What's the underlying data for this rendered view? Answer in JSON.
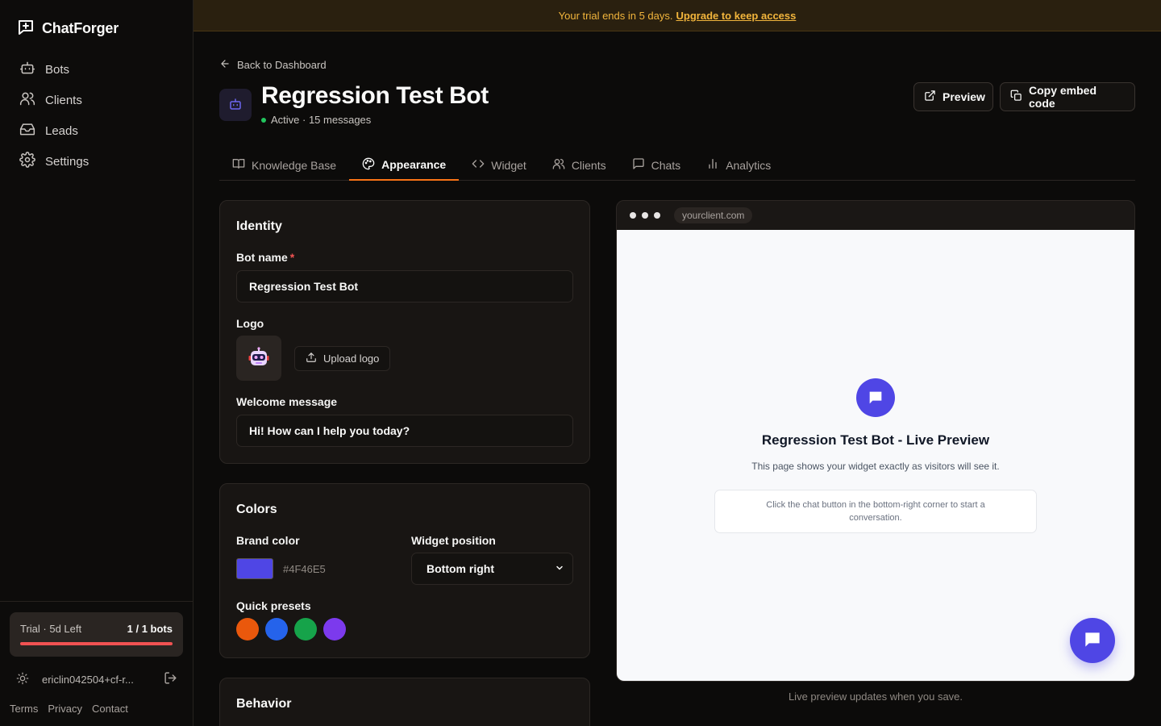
{
  "app": {
    "name": "ChatForger"
  },
  "sidebar": {
    "items": [
      {
        "label": "Bots",
        "icon": "bot-icon"
      },
      {
        "label": "Clients",
        "icon": "users-icon"
      },
      {
        "label": "Leads",
        "icon": "inbox-icon"
      },
      {
        "label": "Settings",
        "icon": "gear-icon"
      }
    ],
    "trial": {
      "label": "Trial · 5d Left",
      "bots": "1 / 1 bots",
      "progress": 1.0
    },
    "user": {
      "email": "ericlin042504+cf-r..."
    },
    "footer": {
      "terms": "Terms",
      "privacy": "Privacy",
      "contact": "Contact"
    }
  },
  "banner": {
    "text": "Your trial ends in 5 days.",
    "link": "Upgrade to keep access",
    "color": "#f2b53c"
  },
  "header": {
    "back": "Back to Dashboard",
    "title": "Regression Test Bot",
    "status": "Active · 15 messages",
    "preview_button": "Preview",
    "embed_button": "Copy embed code"
  },
  "tabs": [
    {
      "label": "Knowledge Base",
      "icon": "book-icon",
      "active": false
    },
    {
      "label": "Appearance",
      "icon": "palette-icon",
      "active": true
    },
    {
      "label": "Widget",
      "icon": "code-icon",
      "active": false
    },
    {
      "label": "Clients",
      "icon": "users-icon",
      "active": false
    },
    {
      "label": "Chats",
      "icon": "message-icon",
      "active": false
    },
    {
      "label": "Analytics",
      "icon": "bar-chart-icon",
      "active": false
    }
  ],
  "identity": {
    "title": "Identity",
    "bot_name_label": "Bot name",
    "required_mark": "*",
    "bot_name_value": "Regression Test Bot",
    "logo_label": "Logo",
    "upload_label": "Upload logo",
    "welcome_label": "Welcome message",
    "welcome_value": "Hi! How can I help you today?"
  },
  "colors": {
    "title": "Colors",
    "brand_label": "Brand color",
    "brand_hex": "#4F46E5",
    "position_label": "Widget position",
    "position_value": "Bottom right",
    "presets_label": "Quick presets",
    "presets": [
      "#ea580c",
      "#2563eb",
      "#16a34a",
      "#7c3aed"
    ]
  },
  "behavior": {
    "title": "Behavior"
  },
  "preview": {
    "url": "yourclient.com",
    "title": "Regression Test Bot - Live Preview",
    "subtitle": "This page shows your widget exactly as visitors will see it.",
    "note": "Click the chat button in the bottom-right corner to start a conversation.",
    "caption": "Live preview updates when you save."
  }
}
